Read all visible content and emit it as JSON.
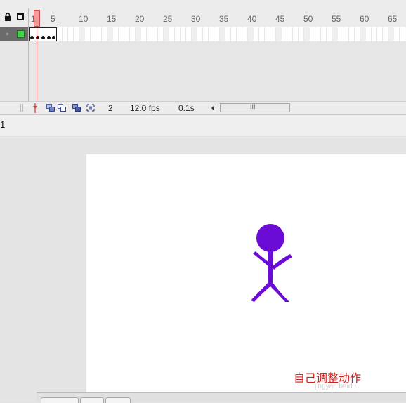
{
  "timeline": {
    "ruler_ticks": [
      "1",
      "5",
      "10",
      "15",
      "20",
      "25",
      "30",
      "35",
      "40",
      "45",
      "50",
      "55",
      "60",
      "65"
    ],
    "current_frame": "1",
    "layer": {
      "color": "#45d34a",
      "keyframe_count": 5
    }
  },
  "status_bar": {
    "current_frame": "2",
    "frame_rate": "12.0 fps",
    "elapsed_time": "0.1s",
    "scroll_grip": "III"
  },
  "edit_bar": {
    "scene_label": "1"
  },
  "stage": {
    "figure_color": "#6a0bd6",
    "caption": "自己调整动作",
    "watermark": "jingyan.baidu"
  },
  "colors": {
    "playhead": "#d13b3b",
    "stage": "#ffffff",
    "caption": "#d12020"
  }
}
